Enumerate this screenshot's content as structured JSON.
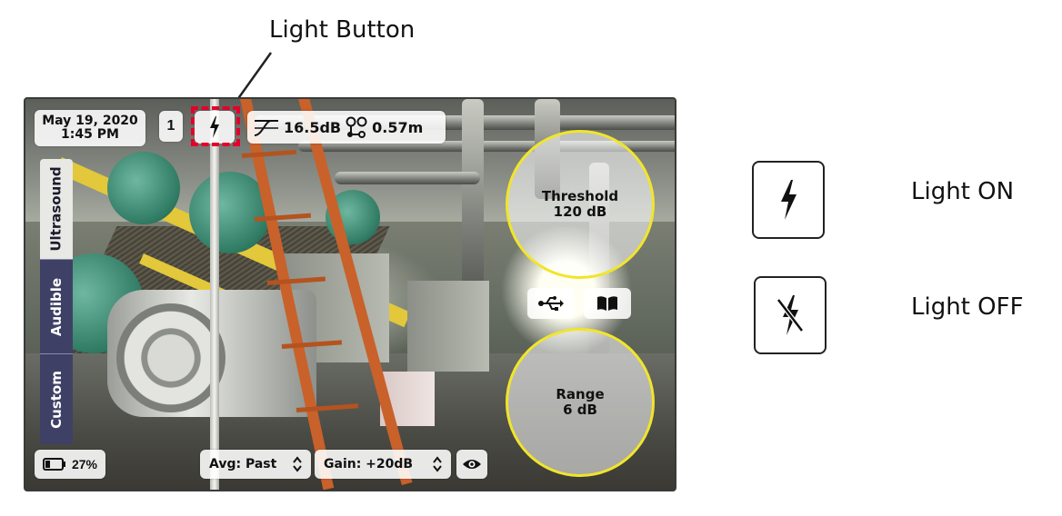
{
  "callout": {
    "title": "Light Button"
  },
  "status_bar": {
    "date": "May 19, 2020",
    "time": "1:45 PM",
    "number": "1",
    "light_state_icon": "lightning-bolt-icon",
    "decibel": "16.5dB",
    "distance": "0.57m"
  },
  "mode_tabs": [
    {
      "label": "Ultrasound",
      "active": true
    },
    {
      "label": "Audible",
      "active": false
    },
    {
      "label": "Custom",
      "active": false
    }
  ],
  "threshold": {
    "label": "Threshold",
    "value": "120 dB"
  },
  "range": {
    "label": "Range",
    "value": "6 dB"
  },
  "tool_icons": [
    "usb-icon",
    "book-icon"
  ],
  "bottom_bar": {
    "battery": "27%",
    "averaging": "Avg: Past",
    "gain": "Gain: +20dB",
    "view_icon": "eye-icon"
  },
  "legend": {
    "on_label": "Light ON",
    "off_label": "Light OFF"
  },
  "colors": {
    "highlight": "#e4002b",
    "circle_border": "#f1e52a",
    "tab_inactive": "#3f4066"
  }
}
